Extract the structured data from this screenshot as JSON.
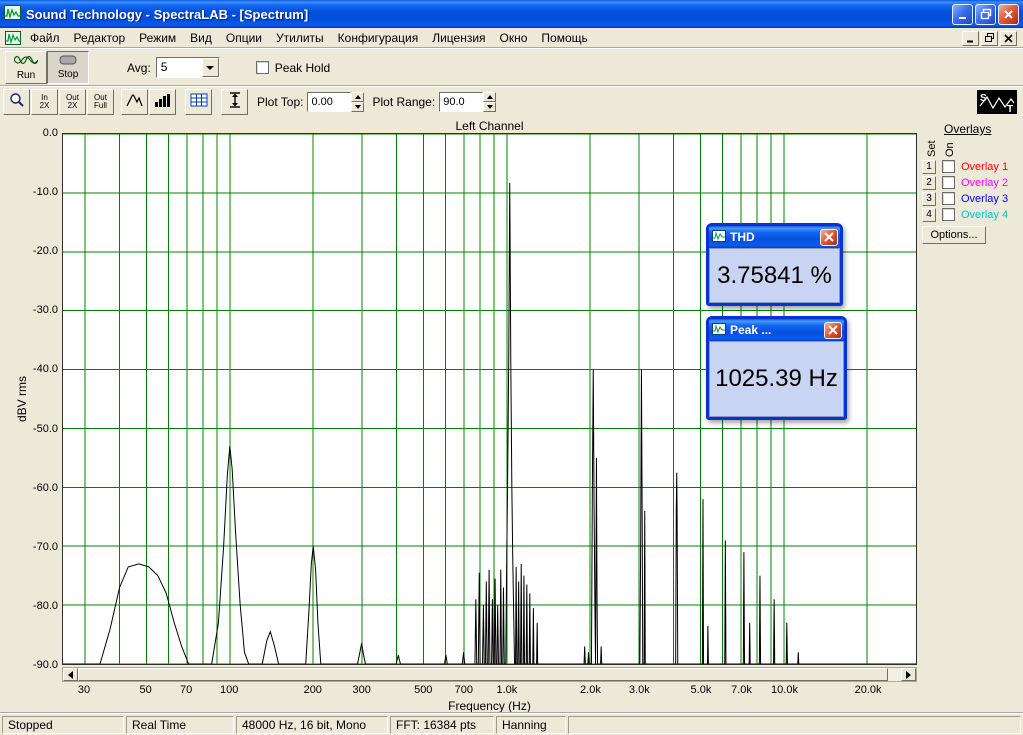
{
  "titlebar": {
    "title": "Sound Technology - SpectraLAB - [Spectrum]"
  },
  "menubar": {
    "items": [
      "Файл",
      "Редактор",
      "Режим",
      "Вид",
      "Опции",
      "Утилиты",
      "Конфигурация",
      "Лицензия",
      "Окно",
      "Помощь"
    ]
  },
  "toolbar": {
    "run": "Run",
    "stop": "Stop",
    "avg_label": "Avg:",
    "avg_value": "5",
    "peak_hold": "Peak Hold",
    "zoom_in": {
      "l1": "In",
      "l2": "2X"
    },
    "zoom_out": {
      "l1": "Out",
      "l2": "2X"
    },
    "zoom_full": {
      "l1": "Out",
      "l2": "Full"
    },
    "plot_top_label": "Plot Top:",
    "plot_top_value": "0.00",
    "plot_range_label": "Plot Range:",
    "plot_range_value": "90.0"
  },
  "overlays": {
    "title": "Overlays",
    "col_set": "Set",
    "col_on": "On",
    "items": [
      {
        "num": "1",
        "label": "Overlay 1",
        "color": "#ff0000"
      },
      {
        "num": "2",
        "label": "Overlay 2",
        "color": "#ff00ff"
      },
      {
        "num": "3",
        "label": "Overlay 3",
        "color": "#0000ff"
      },
      {
        "num": "4",
        "label": "Overlay 4",
        "color": "#00c8c8"
      }
    ],
    "options": "Options..."
  },
  "windows": {
    "thd": {
      "title": "THD",
      "value": "3.75841 %"
    },
    "peak": {
      "title": "Peak ...",
      "value": "1025.39 Hz"
    }
  },
  "statusbar": {
    "panels": [
      "Stopped",
      "Real Time",
      "48000 Hz, 16 bit, Mono",
      "FFT: 16384 pts",
      "Hanning"
    ]
  },
  "chart_data": {
    "type": "line",
    "title": "Left Channel",
    "xlabel": "Frequency (Hz)",
    "ylabel": "dBV rms",
    "x_scale": "log",
    "x_range": [
      25,
      30000
    ],
    "y_range": [
      -90,
      0
    ],
    "grid": true,
    "grid_color": "#008000",
    "legend": "none",
    "x_ticks": [
      {
        "value": 30,
        "label": "30"
      },
      {
        "value": 50,
        "label": "50"
      },
      {
        "value": 70,
        "label": "70"
      },
      {
        "value": 100,
        "label": "100"
      },
      {
        "value": 200,
        "label": "200"
      },
      {
        "value": 300,
        "label": "300"
      },
      {
        "value": 500,
        "label": "500"
      },
      {
        "value": 700,
        "label": "700"
      },
      {
        "value": 1000,
        "label": "1.0k"
      },
      {
        "value": 2000,
        "label": "2.0k"
      },
      {
        "value": 3000,
        "label": "3.0k"
      },
      {
        "value": 5000,
        "label": "5.0k"
      },
      {
        "value": 7000,
        "label": "7.0k"
      },
      {
        "value": 10000,
        "label": "10.0k"
      },
      {
        "value": 20000,
        "label": "20.0k"
      }
    ],
    "x_minor_ticks": [
      40,
      60,
      80,
      90,
      400,
      600,
      800,
      900,
      4000,
      6000,
      8000,
      9000
    ],
    "y_ticks": [
      {
        "value": 0,
        "label": "0.0"
      },
      {
        "value": -10,
        "label": "-10.0"
      },
      {
        "value": -20,
        "label": "-20.0"
      },
      {
        "value": -30,
        "label": "-30.0"
      },
      {
        "value": -40,
        "label": "-40.0"
      },
      {
        "value": -50,
        "label": "-50.0"
      },
      {
        "value": -60,
        "label": "-60.0"
      },
      {
        "value": -70,
        "label": "-70.0"
      },
      {
        "value": -80,
        "label": "-80.0"
      },
      {
        "value": -90,
        "label": "-90.0"
      }
    ],
    "series": [
      {
        "name": "Left Channel spectrum",
        "color": "#000000",
        "points": [
          [
            25,
            -90
          ],
          [
            34,
            -90
          ],
          [
            37,
            -84
          ],
          [
            40,
            -77
          ],
          [
            43,
            -73.5
          ],
          [
            47,
            -73
          ],
          [
            51,
            -73.5
          ],
          [
            55,
            -75
          ],
          [
            59,
            -78
          ],
          [
            63,
            -83
          ],
          [
            67,
            -87
          ],
          [
            71,
            -90
          ],
          [
            86,
            -90
          ],
          [
            91,
            -83
          ],
          [
            95,
            -70
          ],
          [
            98,
            -58
          ],
          [
            100,
            -53
          ],
          [
            102,
            -57
          ],
          [
            105,
            -68
          ],
          [
            109,
            -80
          ],
          [
            113,
            -88
          ],
          [
            117,
            -90
          ],
          [
            131,
            -90
          ],
          [
            136,
            -86
          ],
          [
            140,
            -84.5
          ],
          [
            145,
            -87
          ],
          [
            150,
            -90
          ],
          [
            188,
            -90
          ],
          [
            193,
            -81
          ],
          [
            197,
            -73
          ],
          [
            200,
            -70
          ],
          [
            204,
            -74
          ],
          [
            208,
            -83
          ],
          [
            213,
            -90
          ],
          [
            289,
            -90
          ],
          [
            295,
            -88
          ],
          [
            299,
            -86.5
          ],
          [
            304,
            -88.5
          ],
          [
            309,
            -90
          ],
          [
            399,
            -90
          ],
          [
            406,
            -88.5
          ],
          [
            413,
            -90
          ],
          [
            596,
            -90
          ],
          [
            603,
            -88.5
          ],
          [
            610,
            -90
          ],
          [
            691,
            -90
          ],
          [
            698,
            -88
          ],
          [
            705,
            -90
          ],
          [
            767,
            -90
          ],
          [
            773,
            -79
          ],
          [
            779,
            -90
          ],
          [
            789,
            -90
          ],
          [
            795,
            -74.5
          ],
          [
            801,
            -90
          ],
          [
            817,
            -90
          ],
          [
            823,
            -80
          ],
          [
            829,
            -90
          ],
          [
            837,
            -90
          ],
          [
            843,
            -76
          ],
          [
            849,
            -90
          ],
          [
            857,
            -90
          ],
          [
            863,
            -74
          ],
          [
            869,
            -90
          ],
          [
            881,
            -90
          ],
          [
            887,
            -79
          ],
          [
            893,
            -90
          ],
          [
            901,
            -90
          ],
          [
            907,
            -75.5
          ],
          [
            913,
            -90
          ],
          [
            921,
            -90
          ],
          [
            927,
            -80
          ],
          [
            933,
            -90
          ],
          [
            945,
            -90
          ],
          [
            951,
            -74
          ],
          [
            957,
            -90
          ],
          [
            967,
            -90
          ],
          [
            973,
            -77
          ],
          [
            979,
            -90
          ],
          [
            991,
            -90
          ],
          [
            999,
            -73
          ],
          [
            1007,
            -58
          ],
          [
            1016,
            -38
          ],
          [
            1025,
            -8.3
          ],
          [
            1034,
            -40
          ],
          [
            1043,
            -60
          ],
          [
            1051,
            -72
          ],
          [
            1059,
            -82
          ],
          [
            1066,
            -90
          ],
          [
            1075,
            -90
          ],
          [
            1081,
            -73.5
          ],
          [
            1087,
            -90
          ],
          [
            1097,
            -90
          ],
          [
            1103,
            -76
          ],
          [
            1109,
            -90
          ],
          [
            1121,
            -90
          ],
          [
            1127,
            -73
          ],
          [
            1133,
            -90
          ],
          [
            1147,
            -90
          ],
          [
            1153,
            -75
          ],
          [
            1159,
            -90
          ],
          [
            1175,
            -90
          ],
          [
            1181,
            -76.5
          ],
          [
            1187,
            -90
          ],
          [
            1205,
            -90
          ],
          [
            1211,
            -78
          ],
          [
            1217,
            -90
          ],
          [
            1241,
            -90
          ],
          [
            1247,
            -80.5
          ],
          [
            1253,
            -90
          ],
          [
            1281,
            -90
          ],
          [
            1287,
            -83
          ],
          [
            1293,
            -90
          ],
          [
            1901,
            -90
          ],
          [
            1911,
            -87
          ],
          [
            1921,
            -90
          ],
          [
            1961,
            -90
          ],
          [
            1971,
            -88
          ],
          [
            1981,
            -90
          ],
          [
            2021,
            -90
          ],
          [
            2036,
            -60
          ],
          [
            2051,
            -40
          ],
          [
            2066,
            -63
          ],
          [
            2081,
            -81
          ],
          [
            2091,
            -90
          ],
          [
            2106,
            -55
          ],
          [
            2116,
            -76
          ],
          [
            2126,
            -90
          ],
          [
            2181,
            -90
          ],
          [
            2191,
            -87
          ],
          [
            2201,
            -90
          ],
          [
            3021,
            -90
          ],
          [
            3041,
            -70
          ],
          [
            3062,
            -40
          ],
          [
            3082,
            -68
          ],
          [
            3096,
            -90
          ],
          [
            3131,
            -90
          ],
          [
            3146,
            -64
          ],
          [
            3161,
            -90
          ],
          [
            4071,
            -90
          ],
          [
            4091,
            -64
          ],
          [
            4106,
            -57.5
          ],
          [
            4121,
            -66
          ],
          [
            4141,
            -90
          ],
          [
            5081,
            -90
          ],
          [
            5106,
            -62
          ],
          [
            5131,
            -90
          ],
          [
            5301,
            -90
          ],
          [
            5321,
            -83.5
          ],
          [
            5341,
            -90
          ],
          [
            6121,
            -90
          ],
          [
            6151,
            -69
          ],
          [
            6181,
            -90
          ],
          [
            7141,
            -90
          ],
          [
            7176,
            -71
          ],
          [
            7211,
            -90
          ],
          [
            7501,
            -90
          ],
          [
            7531,
            -83
          ],
          [
            7561,
            -90
          ],
          [
            8161,
            -90
          ],
          [
            8201,
            -75
          ],
          [
            8241,
            -90
          ],
          [
            9181,
            -90
          ],
          [
            9226,
            -79
          ],
          [
            9271,
            -90
          ],
          [
            10201,
            -90
          ],
          [
            10251,
            -83
          ],
          [
            10301,
            -90
          ],
          [
            11231,
            -90
          ],
          [
            11276,
            -88
          ],
          [
            11321,
            -90
          ],
          [
            30000,
            -90
          ]
        ]
      }
    ]
  }
}
